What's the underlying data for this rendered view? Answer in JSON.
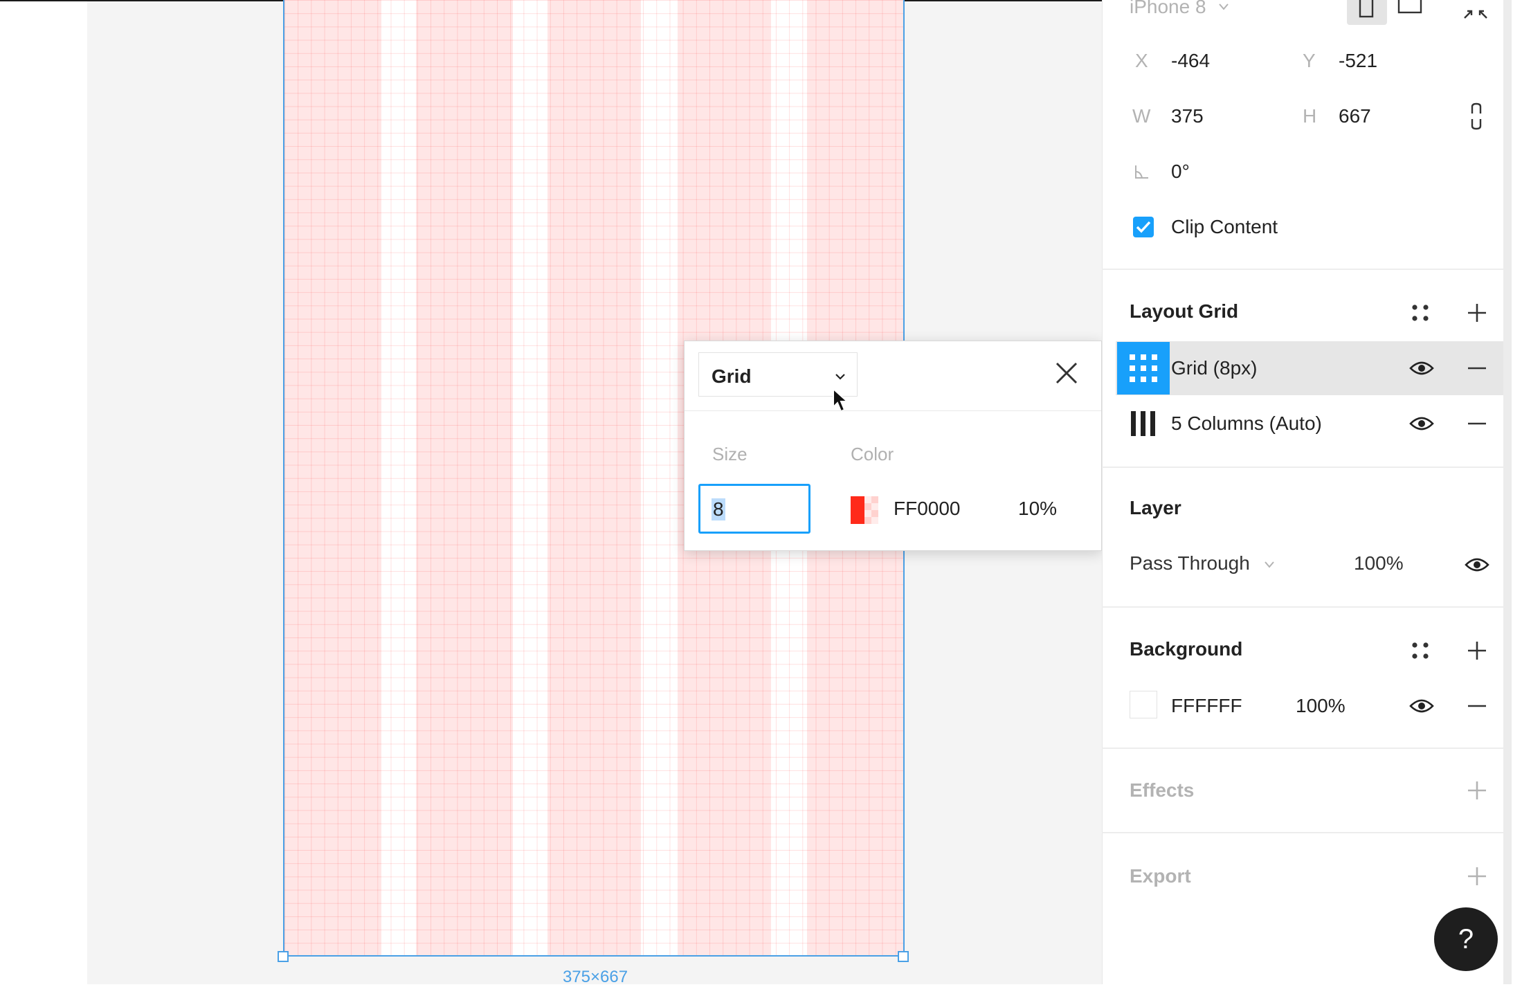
{
  "canvas": {
    "frame_size_label": "375×667"
  },
  "grid_popover": {
    "type_label": "Grid",
    "size_heading": "Size",
    "color_heading": "Color",
    "size_value": "8",
    "color_hex": "FF0000",
    "color_opacity": "10%",
    "accent_color": "#18a0fb",
    "swatch_color": "#ff0000"
  },
  "panel": {
    "device_label": "iPhone 8",
    "x_label": "X",
    "x_value": "-464",
    "y_label": "Y",
    "y_value": "-521",
    "w_label": "W",
    "w_value": "375",
    "h_label": "H",
    "h_value": "667",
    "rotation_value": "0°",
    "clip_content_label": "Clip Content",
    "layout_grid": {
      "title": "Layout Grid",
      "items": [
        {
          "label": "Grid (8px)",
          "icon": "grid-icon"
        },
        {
          "label": "5 Columns (Auto)",
          "icon": "columns-icon"
        }
      ]
    },
    "layer": {
      "title": "Layer",
      "blend_mode": "Pass Through",
      "opacity": "100%"
    },
    "background": {
      "title": "Background",
      "hex": "FFFFFF",
      "opacity": "100%"
    },
    "effects_title": "Effects",
    "export_title": "Export",
    "help_label": "?"
  }
}
